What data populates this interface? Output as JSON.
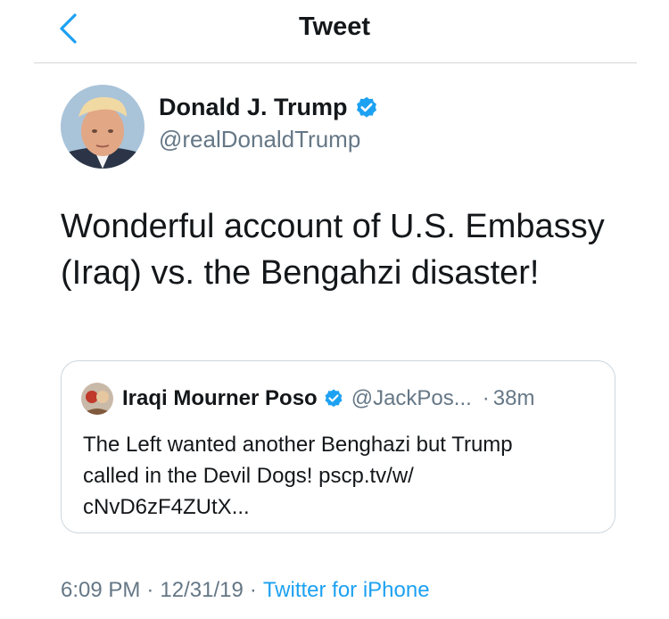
{
  "header": {
    "title": "Tweet",
    "back_icon": "chevron-left-icon",
    "accent_color": "#1da1f2"
  },
  "tweet": {
    "author": {
      "name": "Donald J. Trump",
      "handle": "@realDonaldTrump",
      "verified": true,
      "verified_icon": "verified-badge-icon"
    },
    "text_line1": "Wonderful account of U.S. Embassy",
    "text_line2": "(Iraq) vs. the Bengahzi disaster!",
    "quote": {
      "name": "Iraqi Mourner Poso",
      "handle": "@JackPos...",
      "dot": "·",
      "time": "38m",
      "verified": true,
      "text_line1": "The Left wanted another Benghazi but Trump",
      "text_line2": "called in the Devil Dogs! pscp.tv/w/",
      "text_line3": "cNvD6zF4ZUtX..."
    },
    "meta": {
      "time": "6:09 PM",
      "sep": "·",
      "date": "12/31/19",
      "source": "Twitter for iPhone"
    }
  },
  "colors": {
    "text": "#14171a",
    "secondary": "#657786",
    "link": "#1da1f2",
    "border": "#ccd6dd"
  }
}
